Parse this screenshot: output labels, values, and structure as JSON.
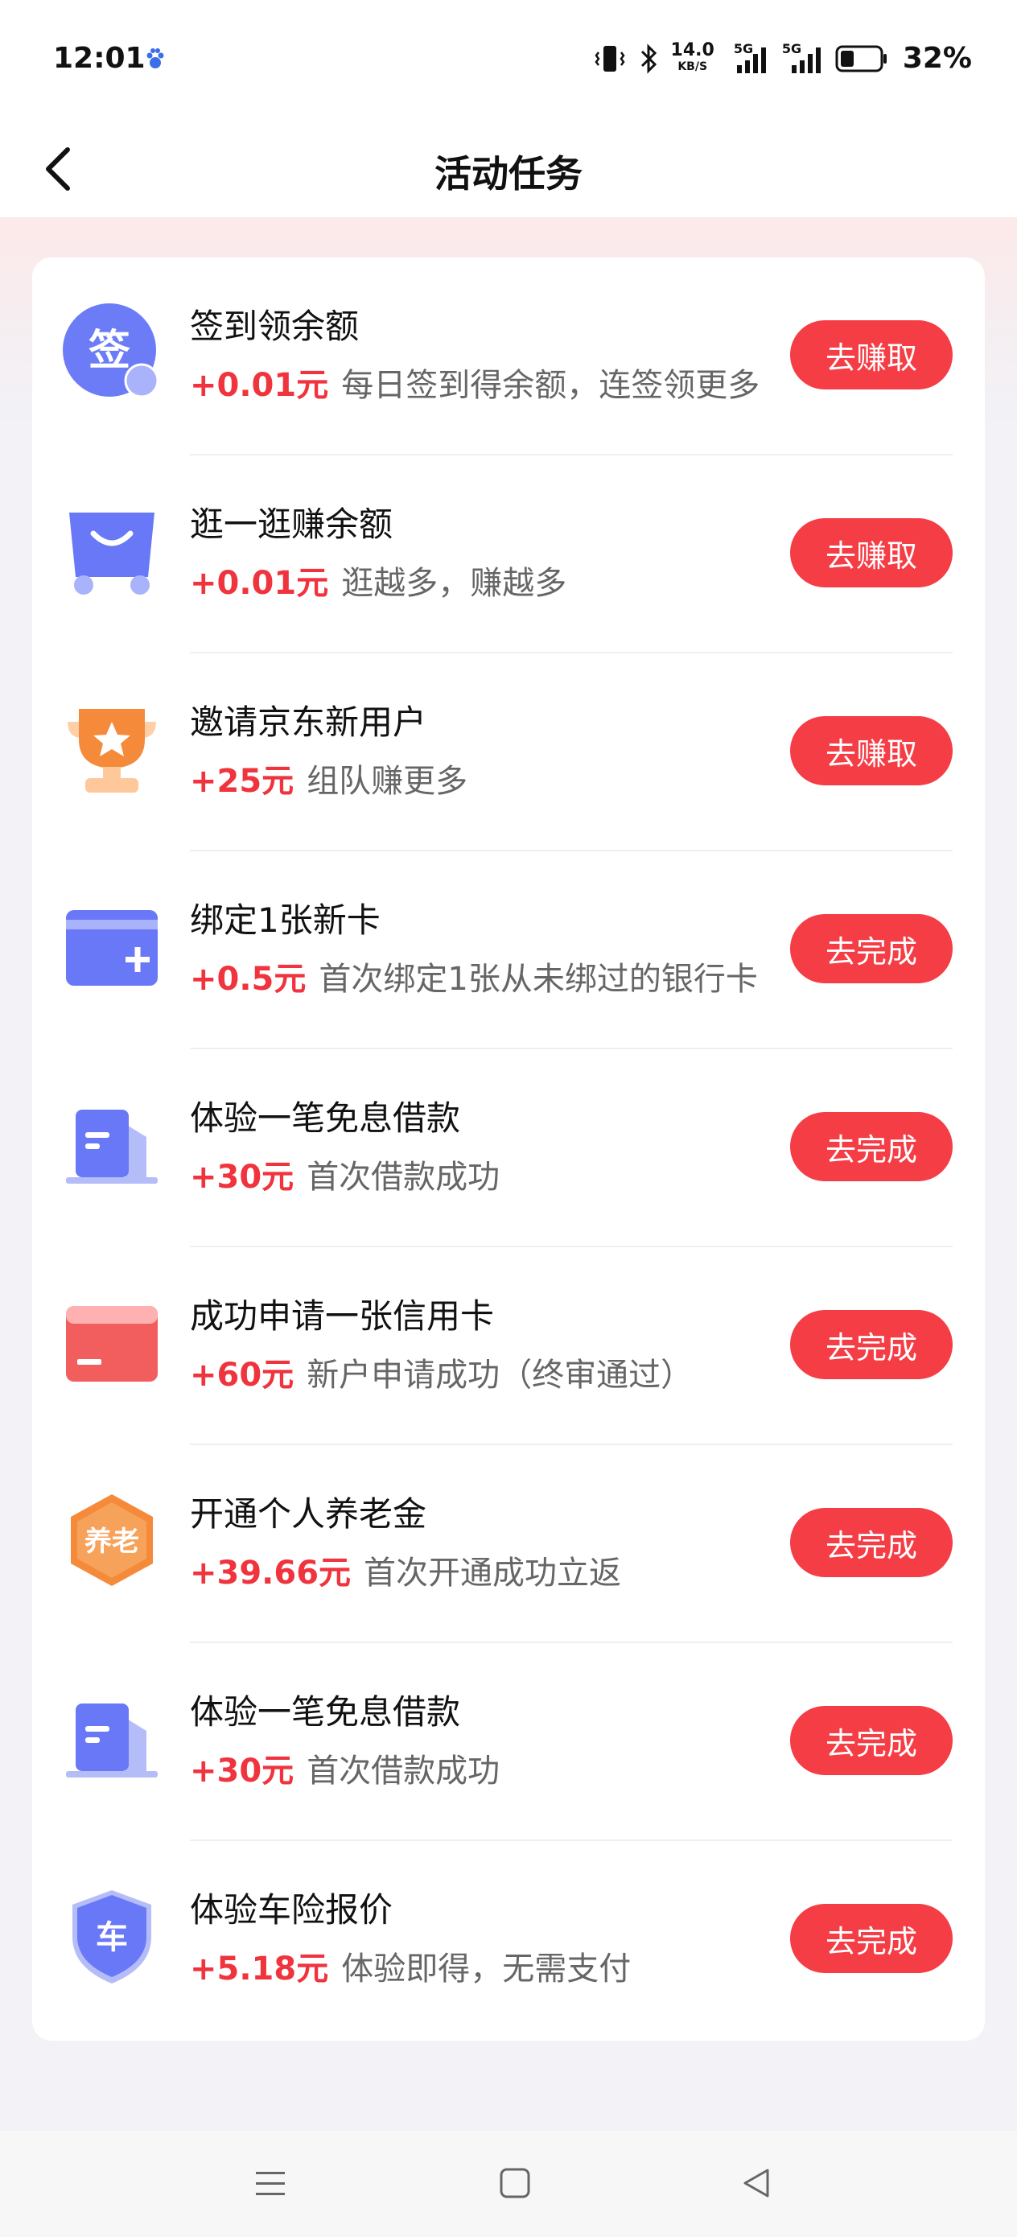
{
  "status_bar": {
    "time": "12:01",
    "net_speed": "14.0",
    "net_unit": "KB/S",
    "signal1": "5G",
    "signal2": "5G",
    "battery": "32%"
  },
  "header": {
    "title": "活动任务"
  },
  "tasks": [
    {
      "icon": "sign-in-icon",
      "title": "签到领余额",
      "reward": "+0.01元",
      "desc": "每日签到得余额，连签领更多",
      "button": "去赚取"
    },
    {
      "icon": "shopping-bag-icon",
      "title": "逛一逛赚余额",
      "reward": "+0.01元",
      "desc": "逛越多，赚越多",
      "button": "去赚取"
    },
    {
      "icon": "trophy-icon",
      "title": "邀请京东新用户",
      "reward": "+25元",
      "desc": "组队赚更多",
      "button": "去赚取"
    },
    {
      "icon": "add-card-icon",
      "title": "绑定1张新卡",
      "reward": "+0.5元",
      "desc": "首次绑定1张从未绑过的银行卡",
      "button": "去完成"
    },
    {
      "icon": "document-icon",
      "title": "体验一笔免息借款",
      "reward": "+30元",
      "desc": "首次借款成功",
      "button": "去完成"
    },
    {
      "icon": "credit-card-icon",
      "title": "成功申请一张信用卡",
      "reward": "+60元",
      "desc": "新户申请成功（终审通过）",
      "button": "去完成"
    },
    {
      "icon": "pension-badge-icon",
      "title": "开通个人养老金",
      "reward": "+39.66元",
      "desc": "首次开通成功立返",
      "button": "去完成"
    },
    {
      "icon": "document-icon",
      "title": "体验一笔免息借款",
      "reward": "+30元",
      "desc": "首次借款成功",
      "button": "去完成"
    },
    {
      "icon": "car-shield-icon",
      "title": "体验车险报价",
      "reward": "+5.18元",
      "desc": "体验即得，无需支付",
      "button": "去完成"
    }
  ],
  "icon_text": {
    "sign": "签",
    "pension": "养老",
    "car": "车"
  },
  "colors": {
    "accent": "#f53d46",
    "reward": "#f0343e",
    "icon_blue": "#6c7cf7"
  }
}
